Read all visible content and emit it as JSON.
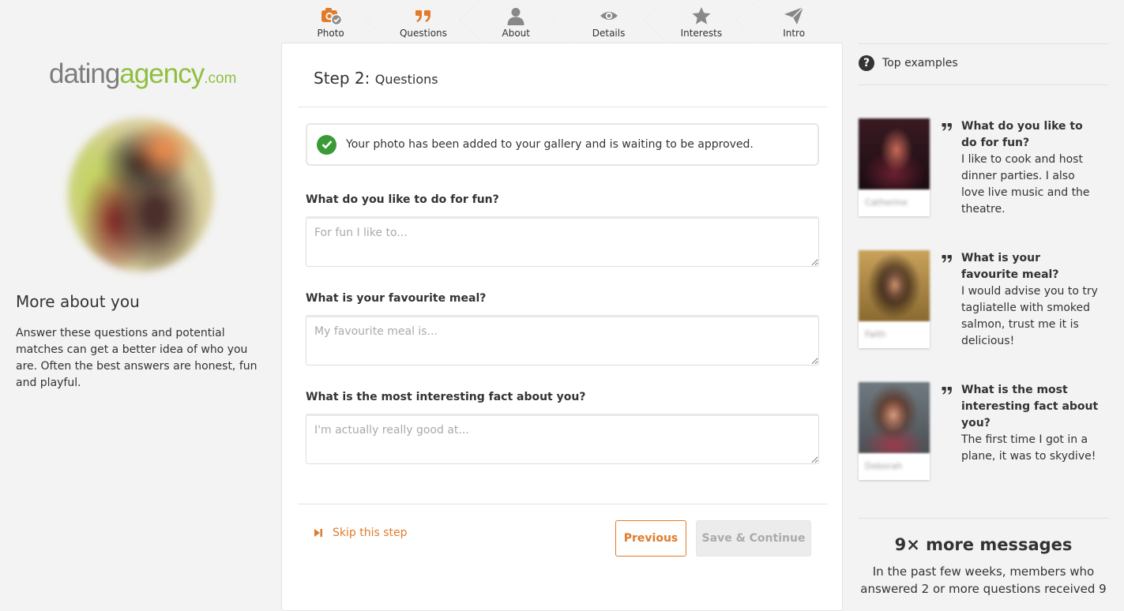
{
  "steps": [
    {
      "label": "Photo",
      "icon": "camera-icon",
      "state": "done"
    },
    {
      "label": "Questions",
      "icon": "quote-icon",
      "state": "active"
    },
    {
      "label": "About",
      "icon": "person-icon",
      "state": "pending"
    },
    {
      "label": "Details",
      "icon": "eye-icon",
      "state": "pending"
    },
    {
      "label": "Interests",
      "icon": "star-icon",
      "state": "pending"
    },
    {
      "label": "Intro",
      "icon": "paper-plane-icon",
      "state": "pending"
    }
  ],
  "logo": {
    "part1": "dating",
    "part2": "agency",
    "part3": ".com"
  },
  "sidebar": {
    "title": "More about you",
    "text": "Answer these questions and potential matches can get a better idea of who you are. Often the best answers are honest, fun and playful."
  },
  "panel": {
    "step_label": "Step 2:",
    "step_name": "Questions",
    "notice": "Your photo has been added to your gallery and is waiting to be approved.",
    "questions": [
      {
        "label": "What do you like to do for fun?",
        "placeholder": "For fun I like to...",
        "value": ""
      },
      {
        "label": "What is your favourite meal?",
        "placeholder": "My favourite meal is...",
        "value": ""
      },
      {
        "label": "What is the most interesting fact about you?",
        "placeholder": "I'm actually really good at...",
        "value": ""
      }
    ],
    "skip_label": "Skip this step",
    "previous_label": "Previous",
    "save_label": "Save & Continue"
  },
  "examples": {
    "title": "Top examples",
    "items": [
      {
        "name": "Catherine",
        "question": "What do you like to do for fun?",
        "answer": "I like to cook and host dinner parties. I also love live music and the theatre."
      },
      {
        "name": "Faith",
        "question": "What is your favourite meal?",
        "answer": "I would advise you to try tagliatelle with smoked salmon, trust me it is delicious!"
      },
      {
        "name": "Deborah",
        "question": "What is the most interesting fact about you?",
        "answer": "The first time I got in a plane, it was to skydive!"
      }
    ]
  },
  "promo": {
    "title": "9× more messages",
    "text": "In the past few weeks, members who answered 2 or more questions received 9"
  },
  "colors": {
    "accent": "#e07b2c",
    "brand_green": "#8fbf3f",
    "success": "#3a9b36"
  }
}
